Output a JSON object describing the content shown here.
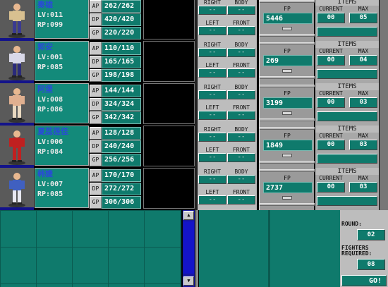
{
  "fighters": [
    {
      "name": "秦雄",
      "lv": "LV:011",
      "rp": "RP:099",
      "ap": "262/262",
      "dp": "420/420",
      "gp": "220/220",
      "fp": "5446",
      "current": "00",
      "max": "05",
      "shirt": "#d8c090",
      "pants": "#3a3a90"
    },
    {
      "name": "郭安",
      "lv": "LV:001",
      "rp": "RP:085",
      "ap": "110/110",
      "dp": "165/165",
      "gp": "198/198",
      "fp": "269",
      "current": "00",
      "max": "04",
      "shirt": "#d8d8e8",
      "pants": "#2a2a7a"
    },
    {
      "name": "阿堡",
      "lv": "LV:008",
      "rp": "RP:086",
      "ap": "144/144",
      "dp": "324/324",
      "gp": "342/342",
      "fp": "3199",
      "current": "00",
      "max": "03",
      "shirt": "#e0b090",
      "pants": "#e8d8c0"
    },
    {
      "name": "夏蕊莲佳",
      "lv": "LV:006",
      "rp": "RP:084",
      "ap": "128/128",
      "dp": "240/240",
      "gp": "256/256",
      "fp": "1849",
      "current": "00",
      "max": "03",
      "shirt": "#c02020",
      "pants": "#c02020"
    },
    {
      "name": "韩婕",
      "lv": "LV:007",
      "rp": "RP:085",
      "ap": "170/170",
      "dp": "272/272",
      "gp": "306/306",
      "fp": "2737",
      "current": "00",
      "max": "03",
      "shirt": "#4060c0",
      "pants": "#e8e8f0"
    }
  ],
  "labels": {
    "ap": "AP",
    "dp": "DP",
    "gp": "GP",
    "right": "RIGHT",
    "body": "BODY",
    "left": "LEFT",
    "front": "FRONT",
    "fp": "FP",
    "items": "ITEMS",
    "current": "CURRENT",
    "max": "MAX",
    "empty_slot": "--"
  },
  "round_panel": {
    "round_label": "ROUND:",
    "round_value": "02",
    "fighters_label_1": "FIGHTERS",
    "fighters_label_2": "REQUIRED:",
    "fighters_value": "08",
    "go_label": "GO!"
  },
  "scroll": {
    "up": "▲",
    "down": "▼"
  },
  "colors": {
    "panel_teal": "#0f7a6c",
    "scroll_blue": "#1818a0",
    "name_blue": "#2a4ad8"
  }
}
